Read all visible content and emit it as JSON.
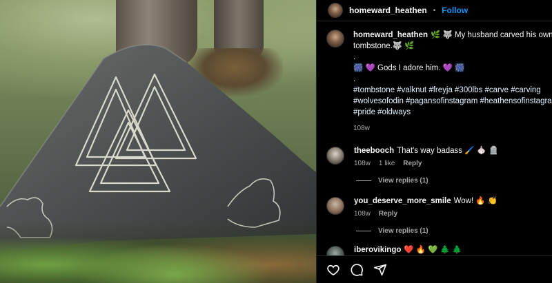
{
  "header": {
    "username": "homeward_heathen",
    "separator": "•",
    "follow_label": "Follow"
  },
  "caption": {
    "username": "homeward_heathen",
    "line1": "🌿 🐺 My husband carved his own",
    "line2": "tombstone.🐺 🌿",
    "line3": ".",
    "line4": "🎆 💜  Gods I adore him. 💜 🎆",
    "line5": ".",
    "line6": "#tombstone #valknut #freyja #300lbs #carve #carving",
    "line7": "#wolvesofodin #pagansofinstagram #heathensofinstagram",
    "line8": "#pride #oldways",
    "time": "108w"
  },
  "comments": [
    {
      "username": "theebooch",
      "text": "That's way badass 🖌️ 🧄 🪦",
      "time": "108w",
      "likes": "1 like",
      "reply_label": "Reply",
      "view_replies": "View replies (1)"
    },
    {
      "username": "you_deserve_more_smile",
      "text": "Wow! 🔥 👏",
      "time": "108w",
      "likes": "",
      "reply_label": "Reply",
      "view_replies": "View replies (1)"
    },
    {
      "username": "iberovikingo",
      "text": "❤️ 🔥 💚 🌲 🌲",
      "time": "",
      "likes": "",
      "reply_label": "",
      "view_replies": ""
    }
  ],
  "actions": {
    "icons": [
      "heart-icon",
      "comment-icon",
      "share-icon"
    ]
  },
  "colors": {
    "accent": "#0095f6",
    "secondary_text": "#a8a8a8",
    "background": "#000000"
  }
}
